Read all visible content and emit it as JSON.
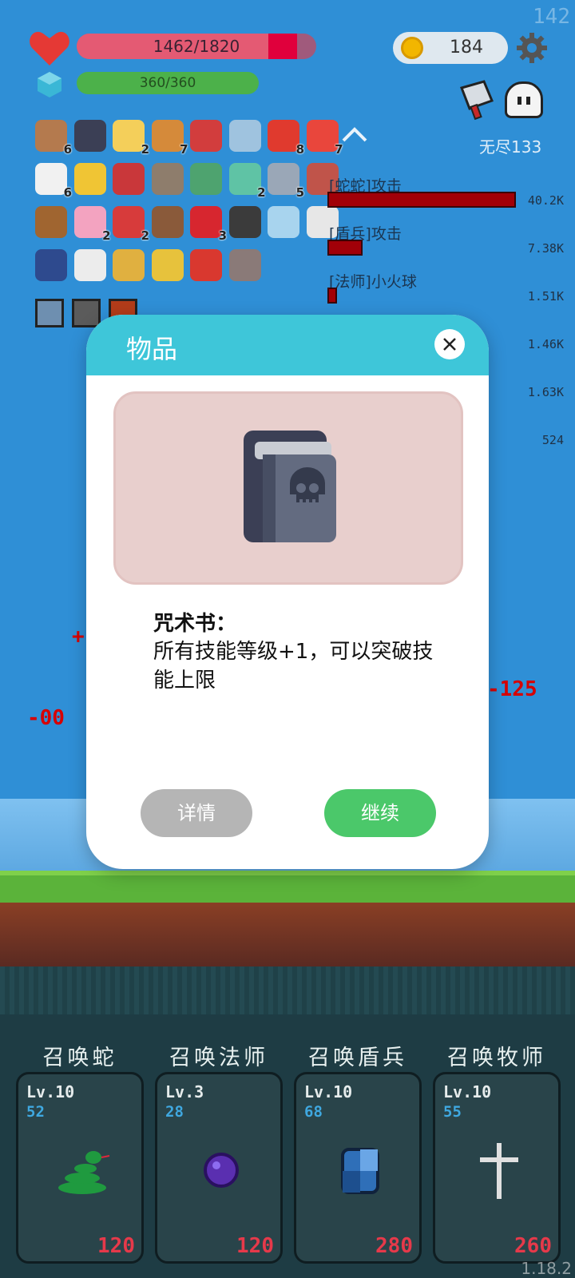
{
  "fps": "142",
  "status": {
    "hp_text": "1462/1820",
    "mp_text": "360/360",
    "coins": "184"
  },
  "mode_label": "无尽133",
  "items": [
    {
      "icon": "target-icon",
      "count": "6"
    },
    {
      "icon": "skull-book-icon",
      "count": ""
    },
    {
      "icon": "cheese-icon",
      "count": "2"
    },
    {
      "icon": "scroll-book-icon",
      "count": "7"
    },
    {
      "icon": "magnet-icon",
      "count": ""
    },
    {
      "icon": "magnifier-icon",
      "count": ""
    },
    {
      "icon": "apple-icon",
      "count": "8"
    },
    {
      "icon": "watermelon-icon",
      "count": "7"
    },
    {
      "icon": "flower-icon",
      "count": "6"
    },
    {
      "icon": "magic-wand-icon",
      "count": ""
    },
    {
      "icon": "shield-icon",
      "count": ""
    },
    {
      "icon": "meteor-icon",
      "count": ""
    },
    {
      "icon": "tent-icon",
      "count": ""
    },
    {
      "icon": "syringe-icon",
      "count": "2"
    },
    {
      "icon": "sword-icon",
      "count": "5"
    },
    {
      "icon": "hook-icon",
      "count": ""
    },
    {
      "icon": "meat-icon",
      "count": ""
    },
    {
      "icon": "ice-cream-icon",
      "count": "2"
    },
    {
      "icon": "strawberry-icon",
      "count": "2"
    },
    {
      "icon": "coconut-icon",
      "count": ""
    },
    {
      "icon": "bookmark-icon",
      "count": "3"
    },
    {
      "icon": "bomb-icon",
      "count": ""
    },
    {
      "icon": "potion-icon",
      "count": ""
    },
    {
      "icon": "mail-icon",
      "count": ""
    },
    {
      "icon": "holy-book-icon",
      "count": ""
    },
    {
      "icon": "dice-icon",
      "count": ""
    },
    {
      "icon": "battery-icon",
      "count": ""
    },
    {
      "icon": "egg-icon",
      "count": ""
    },
    {
      "icon": "gift-icon",
      "count": ""
    },
    {
      "icon": "tombstone-icon",
      "count": ""
    }
  ],
  "damage_log": [
    {
      "label": "[蛇蛇]攻击",
      "value": "40.2K"
    },
    {
      "label": "[盾兵]攻击",
      "value": "7.38K"
    },
    {
      "label": "[法师]小火球",
      "value": "1.51K"
    },
    {
      "label": "",
      "value": "1.46K"
    },
    {
      "label": "",
      "value": "1.63K"
    },
    {
      "label": "",
      "value": "524"
    }
  ],
  "float_numbers": [
    "-125",
    "-00",
    "+"
  ],
  "modal": {
    "title": "物品",
    "item_name": "咒术书：",
    "item_desc": "所有技能等级+1，可以突破技能上限",
    "detail_button": "详情",
    "continue_button": "继续"
  },
  "summons": [
    {
      "title": "召唤蛇",
      "level": "Lv.10",
      "count": "52",
      "cost": "120",
      "icon": "snake-icon",
      "color": "#1f9a3f"
    },
    {
      "title": "召唤法师",
      "level": "Lv.3",
      "count": "28",
      "cost": "120",
      "icon": "purple-orb-icon",
      "color": "#5a2fb0"
    },
    {
      "title": "召唤盾兵",
      "level": "Lv.10",
      "count": "68",
      "cost": "280",
      "icon": "blue-shield-icon",
      "color": "#2f6fb8"
    },
    {
      "title": "召唤牧师",
      "level": "Lv.10",
      "count": "55",
      "cost": "260",
      "icon": "cross-icon",
      "color": "#e0e0e0"
    }
  ],
  "version": "1.18.2"
}
